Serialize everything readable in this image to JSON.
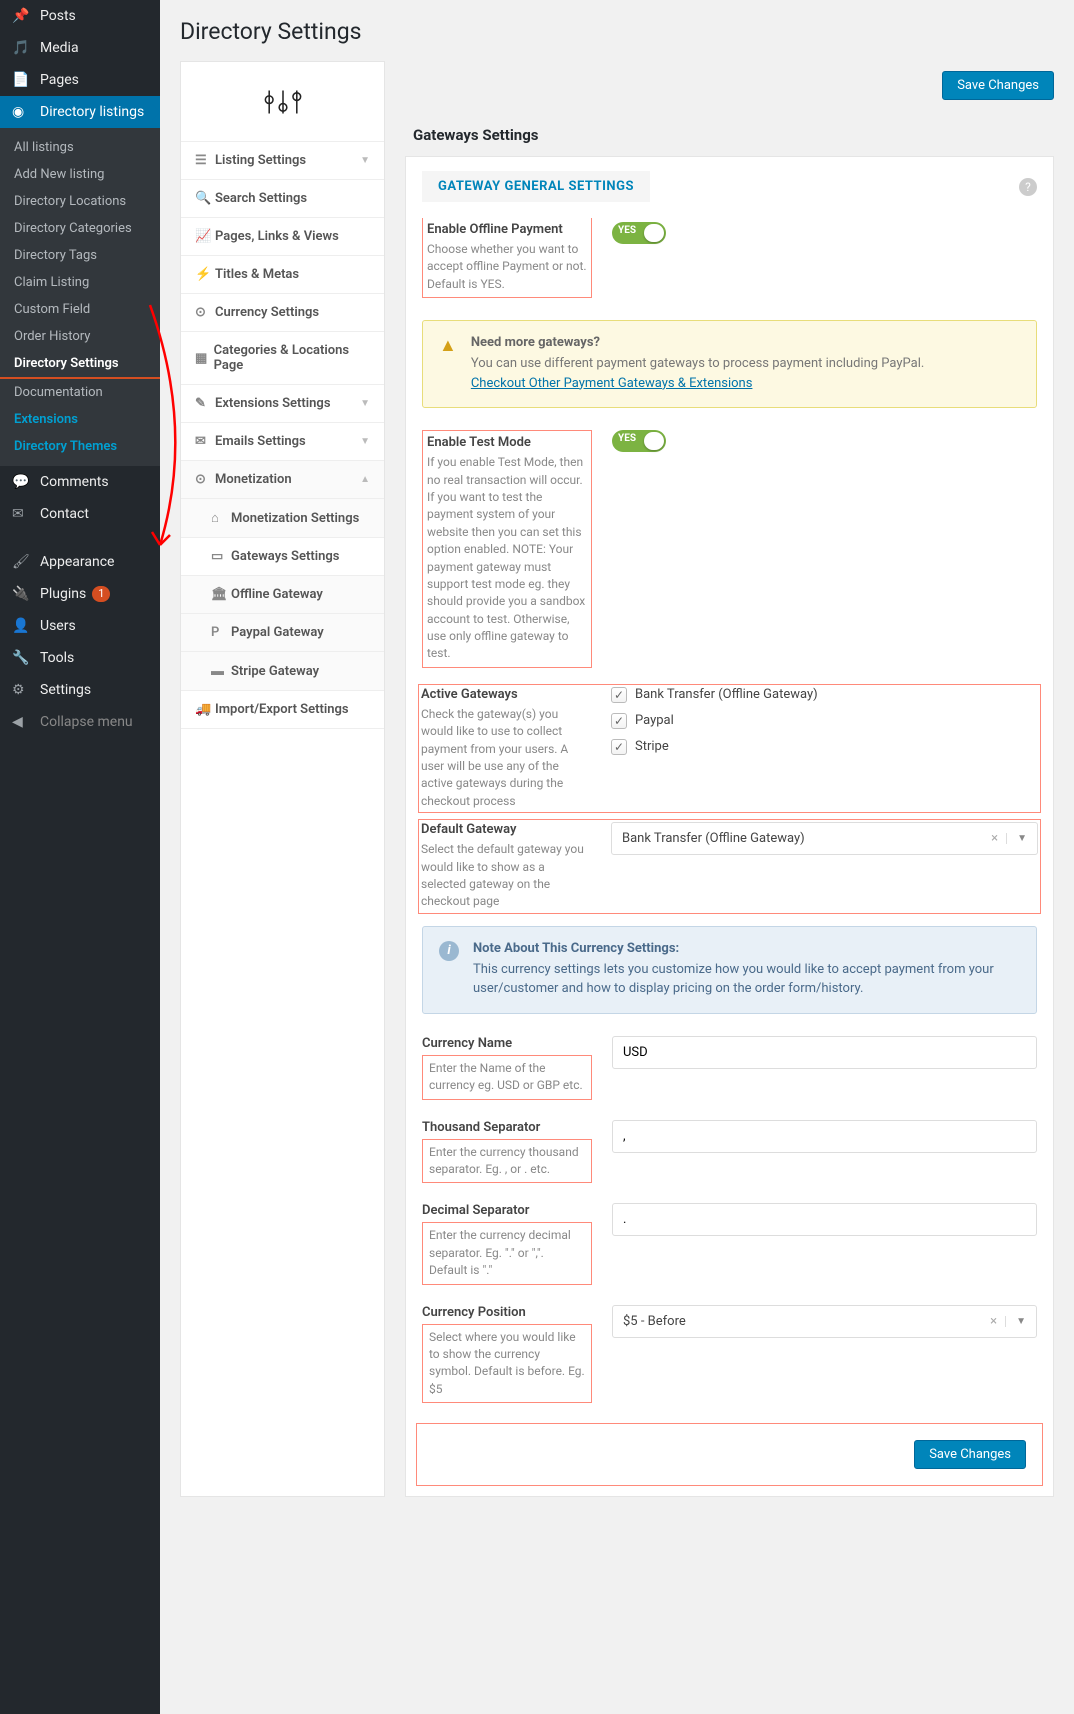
{
  "page_title": "Directory Settings",
  "save_button": "Save Changes",
  "wp_menu": {
    "posts": "Posts",
    "media": "Media",
    "pages": "Pages",
    "directory_listings": "Directory listings",
    "sub": {
      "all": "All listings",
      "add": "Add New listing",
      "locations": "Directory Locations",
      "categories": "Directory Categories",
      "tags": "Directory Tags",
      "claim": "Claim Listing",
      "custom": "Custom Field",
      "order": "Order History",
      "settings": "Directory Settings",
      "docs": "Documentation",
      "ext": "Extensions",
      "themes": "Directory Themes"
    },
    "comments": "Comments",
    "contact": "Contact",
    "appearance": "Appearance",
    "plugins": "Plugins",
    "plugins_badge": "1",
    "users": "Users",
    "tools": "Tools",
    "settings": "Settings",
    "collapse": "Collapse menu"
  },
  "settings_nav": {
    "listing": "Listing Settings",
    "search": "Search Settings",
    "pages": "Pages, Links & Views",
    "titles": "Titles & Metas",
    "currency": "Currency Settings",
    "catloc": "Categories & Locations Page",
    "ext": "Extensions Settings",
    "emails": "Emails Settings",
    "monet": "Monetization",
    "monet_set": "Monetization Settings",
    "gateways": "Gateways Settings",
    "offline": "Offline Gateway",
    "paypal": "Paypal Gateway",
    "stripe": "Stripe Gateway",
    "import": "Import/Export Settings"
  },
  "content": {
    "title": "Gateways Settings",
    "section_tab": "GATEWAY GENERAL SETTINGS",
    "enable_offline": {
      "t": "Enable Offline Payment",
      "d": "Choose whether you want to accept offline Payment or not. Default is YES.",
      "toggle": "YES"
    },
    "warn": {
      "t": "Need more gateways?",
      "b": "You can use different payment gateways to process payment including PayPal.",
      "link": "Checkout Other Payment Gateways & Extensions"
    },
    "test_mode": {
      "t": "Enable Test Mode",
      "d": "If you enable Test Mode, then no real transaction will occur. If you want to test the payment system of your website then you can set this option enabled. NOTE: Your payment gateway must support test mode eg. they should provide you a sandbox account to test. Otherwise, use only offline gateway to test.",
      "toggle": "YES"
    },
    "active": {
      "t": "Active Gateways",
      "d": "Check the gateway(s) you would like to use to collect payment from your users. A user will be use any of the active gateways during the checkout process",
      "o1": "Bank Transfer (Offline Gateway)",
      "o2": "Paypal",
      "o3": "Stripe"
    },
    "default_gw": {
      "t": "Default Gateway",
      "d": "Select the default gateway you would like to show as a selected gateway on the checkout page",
      "v": "Bank Transfer (Offline Gateway)"
    },
    "info": {
      "t": "Note About This Currency Settings:",
      "b": "This currency settings lets you customize how you would like to accept payment from your user/customer and how to display pricing on the order form/history."
    },
    "currency_name": {
      "t": "Currency Name",
      "d": "Enter the Name of the currency eg. USD or GBP etc.",
      "v": "USD"
    },
    "thou": {
      "t": "Thousand Separator",
      "d": "Enter the currency thousand separator. Eg. , or . etc.",
      "v": ","
    },
    "dec": {
      "t": "Decimal Separator",
      "d": "Enter the currency decimal separator. Eg. \".\" or \",\". Default is \".\"",
      "v": "."
    },
    "pos": {
      "t": "Currency Position",
      "d": "Select where you would like to show the currency symbol. Default is before. Eg. $5",
      "v": "$5 - Before"
    }
  }
}
